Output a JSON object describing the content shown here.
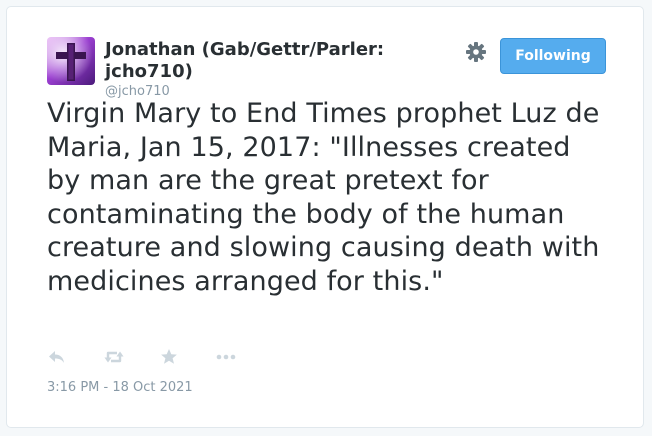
{
  "user": {
    "display_name": "Jonathan (Gab/Gettr/Parler: jcho710)",
    "handle": "@jcho710",
    "avatar_icon": "cross-avatar-icon"
  },
  "header": {
    "follow_label": "Following",
    "settings_icon": "gear-icon"
  },
  "tweet": {
    "text": "Virgin Mary to End Times prophet Luz de Maria, Jan 15, 2017: \"Illnesses created by man are the great pretext for contaminating the body of the human creature and slowing causing death with medicines arranged for this.\"",
    "timestamp": "3:16 PM - 18 Oct 2021"
  },
  "actions": [
    {
      "icon": "reply-icon"
    },
    {
      "icon": "retweet-icon"
    },
    {
      "icon": "star-icon"
    },
    {
      "icon": "more-icon"
    }
  ],
  "colors": {
    "accent": "#55acee",
    "text": "#292f33",
    "muted": "#8899a6",
    "icon": "#ccd6dd"
  }
}
